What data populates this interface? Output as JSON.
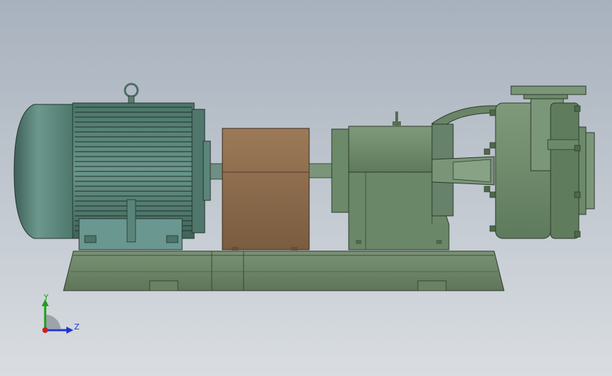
{
  "viewport": {
    "background_top": "#a7b1bd",
    "background_bottom": "#d9dde1"
  },
  "model": {
    "motor_color": "#5f8a80",
    "pump_color": "#6f8a6c",
    "coupling_guard_color": "#8a6a4e",
    "baseplate_color": "#6d8468"
  },
  "triad": {
    "y_label": "Y",
    "z_label": "Z",
    "y_color": "#1aa01a",
    "z_color": "#2035c8",
    "x_color": "#c82020"
  }
}
